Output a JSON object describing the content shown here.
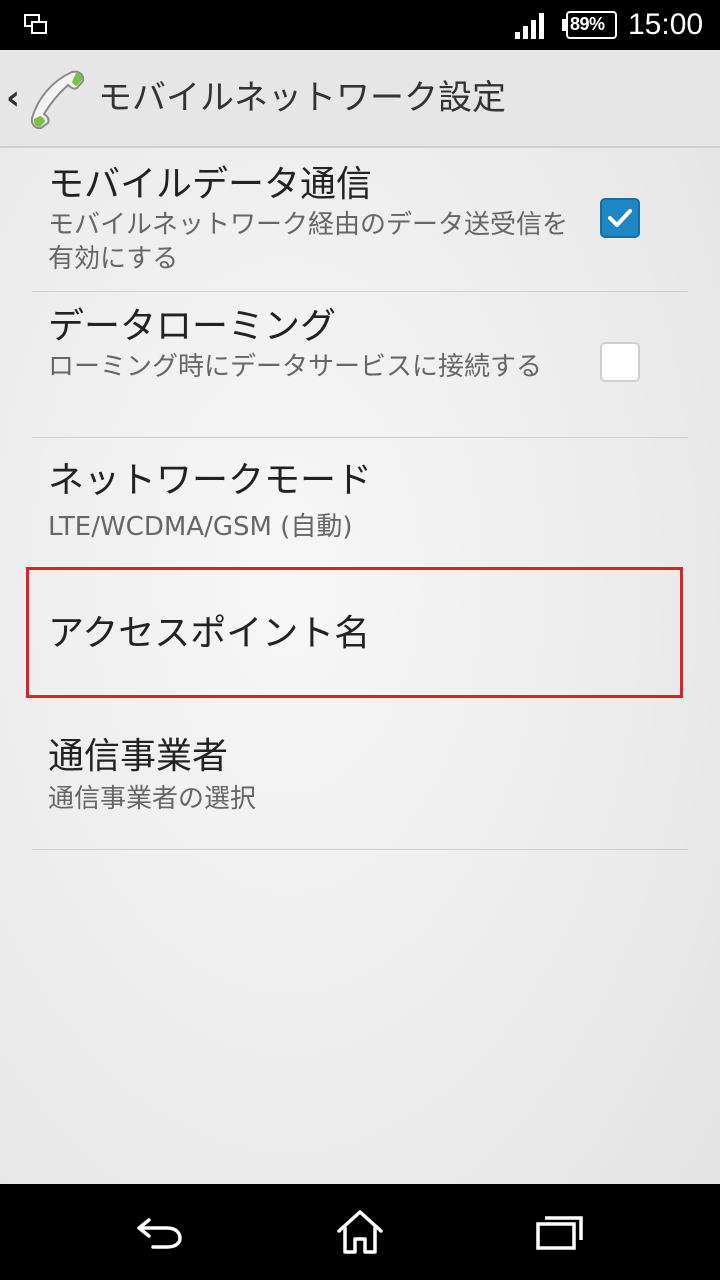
{
  "status_bar": {
    "battery_text": "89%",
    "time": "15:00",
    "icons": [
      "screen-mirror-icon",
      "signal-icon",
      "battery-icon"
    ]
  },
  "action_bar": {
    "title": "モバイルネットワーク設定",
    "icons": [
      "back-chevron-icon",
      "phone-handset-icon"
    ]
  },
  "settings": {
    "mobile_data": {
      "title": "モバイルデータ通信",
      "summary": "モバイルネットワーク経由のデータ送受信を有効にする",
      "checked": true
    },
    "data_roaming": {
      "title": "データローミング",
      "summary": "ローミング時にデータサービスに接続する",
      "checked": false
    },
    "network_mode": {
      "title": "ネットワークモード",
      "summary": "LTE/WCDMA/GSM (自動)"
    },
    "apn": {
      "title": "アクセスポイント名"
    },
    "carrier": {
      "title": "通信事業者",
      "summary": "通信事業者の選択"
    }
  },
  "highlight": {
    "color": "#e11f2a"
  },
  "accent_color": "#1f86c4",
  "nav_bar": {
    "icons": [
      "back-icon",
      "home-icon",
      "recent-apps-icon"
    ]
  }
}
